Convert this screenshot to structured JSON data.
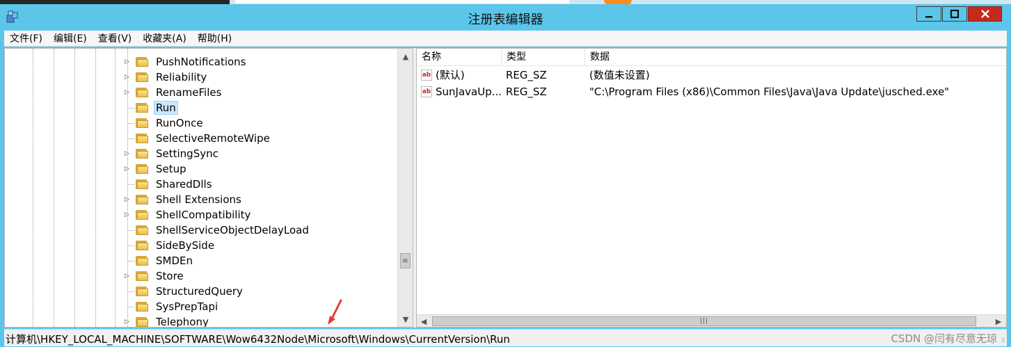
{
  "window": {
    "title": "注册表编辑器"
  },
  "menu": [
    "文件(F)",
    "编辑(E)",
    "查看(V)",
    "收藏夹(A)",
    "帮助(H)"
  ],
  "tree": {
    "items": [
      {
        "label": "PushNotifications",
        "expandable": true
      },
      {
        "label": "Reliability",
        "expandable": true
      },
      {
        "label": "RenameFiles",
        "expandable": true
      },
      {
        "label": "Run",
        "expandable": false,
        "selected": true
      },
      {
        "label": "RunOnce",
        "expandable": false
      },
      {
        "label": "SelectiveRemoteWipe",
        "expandable": false
      },
      {
        "label": "SettingSync",
        "expandable": true
      },
      {
        "label": "Setup",
        "expandable": true
      },
      {
        "label": "SharedDlls",
        "expandable": false
      },
      {
        "label": "Shell Extensions",
        "expandable": true
      },
      {
        "label": "ShellCompatibility",
        "expandable": true
      },
      {
        "label": "ShellServiceObjectDelayLoad",
        "expandable": false
      },
      {
        "label": "SideBySide",
        "expandable": false
      },
      {
        "label": "SMDEn",
        "expandable": false
      },
      {
        "label": "Store",
        "expandable": true
      },
      {
        "label": "StructuredQuery",
        "expandable": false
      },
      {
        "label": "SysPrepTapi",
        "expandable": false
      },
      {
        "label": "Telephony",
        "expandable": true
      }
    ]
  },
  "list": {
    "columns": {
      "name": "名称",
      "type": "类型",
      "data": "数据"
    },
    "rows": [
      {
        "name": "(默认)",
        "type": "REG_SZ",
        "data": "(数值未设置)"
      },
      {
        "name": "SunJavaUp...",
        "type": "REG_SZ",
        "data": "\"C:\\Program Files (x86)\\Common Files\\Java\\Java Update\\jusched.exe\""
      }
    ]
  },
  "status": {
    "path": "计算机\\HKEY_LOCAL_MACHINE\\SOFTWARE\\Wow6432Node\\Microsoft\\Windows\\CurrentVersion\\Run"
  },
  "watermark": "CSDN @闫有尽意无琼",
  "colors": {
    "titlebar": "#5bc6ea",
    "close": "#c42b1c",
    "selection": "#cce8ff",
    "arrow": "#e53935"
  },
  "icons": {
    "value_icon_text": "ab"
  }
}
